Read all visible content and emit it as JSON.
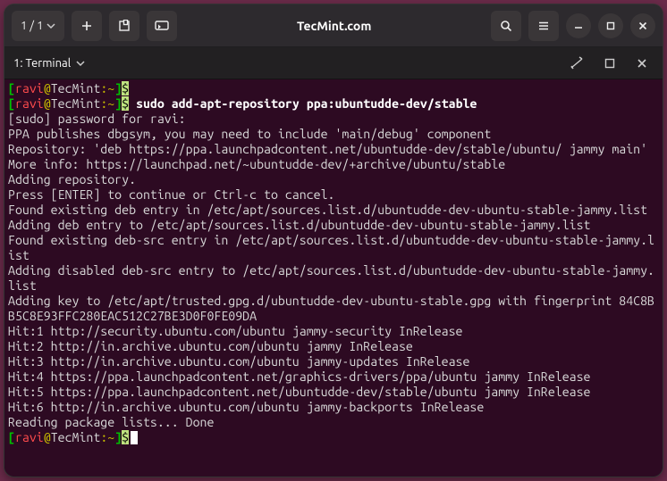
{
  "titlebar": {
    "page_indicator": "1 / 1",
    "title": "TecMint.com"
  },
  "tabbar": {
    "label": "1: Terminal"
  },
  "prompt": {
    "user": "ravi",
    "at": "@",
    "host": "TecMint",
    "sep": ":",
    "path": "~",
    "bracket_open": "[",
    "bracket_close": "]",
    "dollar": "$"
  },
  "commands": {
    "cmd1": " sudo add-apt-repository ppa:ubuntudde-dev/stable"
  },
  "output": {
    "l1": "[sudo] password for ravi: ",
    "l2": "PPA publishes dbgsym, you may need to include 'main/debug' component",
    "l3": "Repository: 'deb https://ppa.launchpadcontent.net/ubuntudde-dev/stable/ubuntu/ jammy main'",
    "l4": "More info: https://launchpad.net/~ubuntudde-dev/+archive/ubuntu/stable",
    "l5": "Adding repository.",
    "l6": "Press [ENTER] to continue or Ctrl-c to cancel.",
    "l7": "Found existing deb entry in /etc/apt/sources.list.d/ubuntudde-dev-ubuntu-stable-jammy.list",
    "l8": "Adding deb entry to /etc/apt/sources.list.d/ubuntudde-dev-ubuntu-stable-jammy.list",
    "l9": "Found existing deb-src entry in /etc/apt/sources.list.d/ubuntudde-dev-ubuntu-stable-jammy.list",
    "l10": "Adding disabled deb-src entry to /etc/apt/sources.list.d/ubuntudde-dev-ubuntu-stable-jammy.list",
    "l11": "Adding key to /etc/apt/trusted.gpg.d/ubuntudde-dev-ubuntu-stable.gpg with fingerprint 84C8BB5C8E93FFC280EAC512C27BE3D0F0FE09DA",
    "l12": "Hit:1 http://security.ubuntu.com/ubuntu jammy-security InRelease",
    "l13": "Hit:2 http://in.archive.ubuntu.com/ubuntu jammy InRelease",
    "l14": "Hit:3 http://in.archive.ubuntu.com/ubuntu jammy-updates InRelease",
    "l15": "Hit:4 https://ppa.launchpadcontent.net/graphics-drivers/ppa/ubuntu jammy InRelease",
    "l16": "Hit:5 https://ppa.launchpadcontent.net/ubuntudde-dev/stable/ubuntu jammy InRelease",
    "l17": "Hit:6 http://in.archive.ubuntu.com/ubuntu jammy-backports InRelease",
    "l18": "Reading package lists... Done"
  }
}
